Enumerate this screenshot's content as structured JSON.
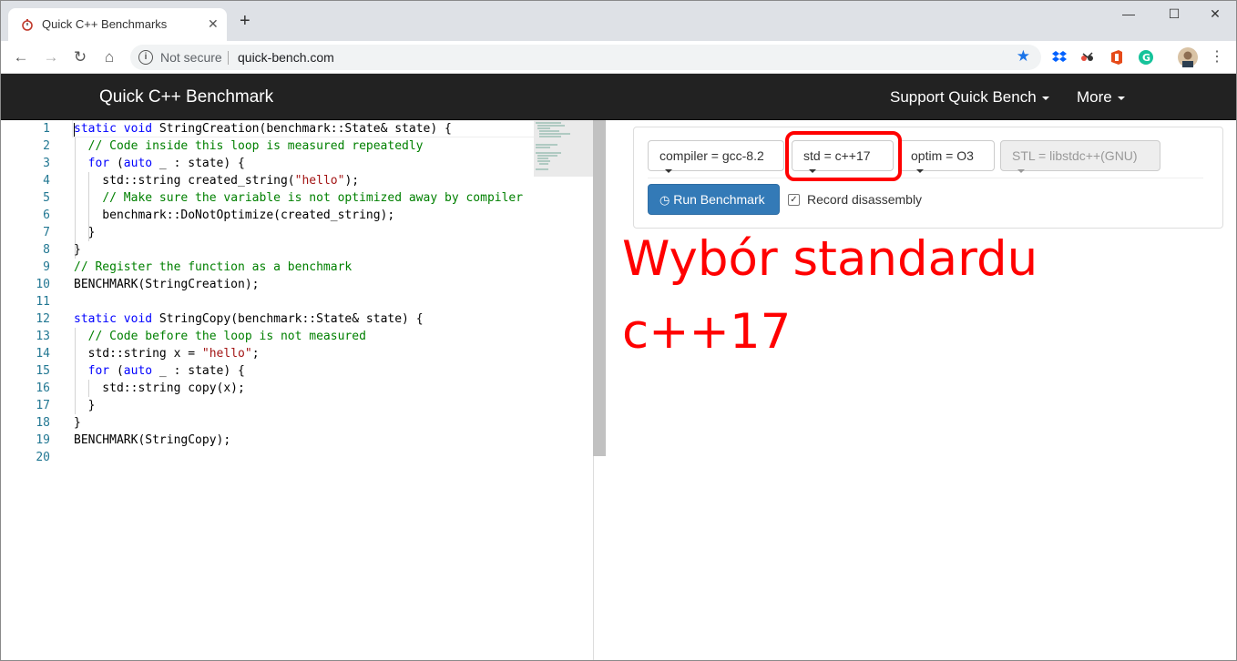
{
  "browser": {
    "tab_title": "Quick C++ Benchmarks",
    "tab_close": "✕",
    "new_tab": "+",
    "window_controls": {
      "minimize": "—",
      "maximize": "☐",
      "close": "✕"
    },
    "security_label": "Not secure",
    "url": "quick-bench.com",
    "nav_icons": [
      "back-arrow-icon",
      "forward-arrow-icon",
      "reload-icon",
      "home-icon"
    ],
    "extension_icons": [
      "dropbox-icon",
      "extension-icon",
      "office-icon",
      "grammarly-icon",
      "profile-avatar",
      "menu-dots-icon"
    ]
  },
  "navbar": {
    "brand": "Quick C++ Benchmark",
    "support": "Support Quick Bench",
    "more": "More"
  },
  "editor": {
    "line_numbers": [
      "1",
      "2",
      "3",
      "4",
      "5",
      "6",
      "7",
      "8",
      "9",
      "10",
      "11",
      "12",
      "13",
      "14",
      "15",
      "16",
      "17",
      "18",
      "19",
      "20"
    ]
  },
  "options": {
    "compiler": "compiler = gcc-8.2",
    "std": "std = c++17",
    "optim": "optim = O3",
    "stl": "STL = libstdc++(GNU)",
    "run_button": "Run Benchmark",
    "record_disassembly": "Record disassembly",
    "record_checked": true
  },
  "annotation": {
    "line1": "Wybór standardu",
    "line2": "c++17",
    "color": "#ff0000"
  },
  "colors": {
    "navbar_bg": "#222222",
    "run_button_bg": "#337ab7",
    "keyword": "#0000ff",
    "comment": "#008000",
    "string": "#a31515",
    "line_number": "#237893"
  }
}
